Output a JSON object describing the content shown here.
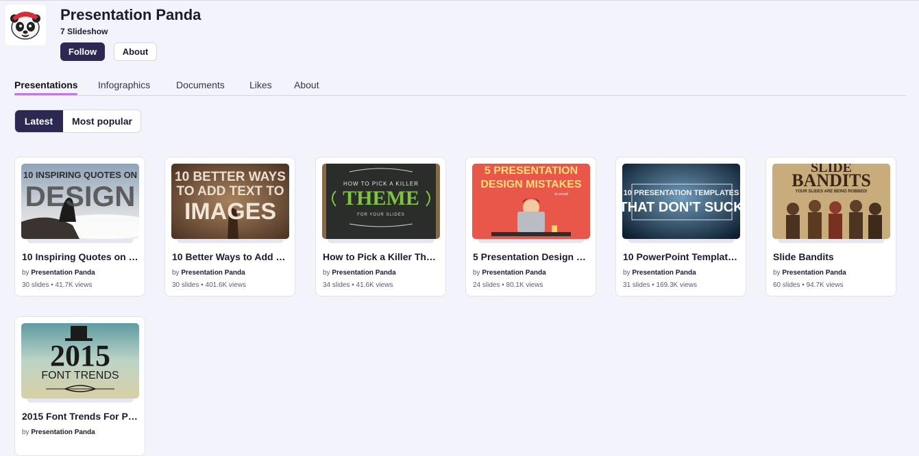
{
  "profile": {
    "name": "Presentation Panda",
    "subtitle": "7 Slideshow",
    "follow_label": "Follow",
    "about_label": "About",
    "avatar_icon": "panda-logo-icon"
  },
  "tabs": [
    {
      "label": "Presentations",
      "active": true
    },
    {
      "label": "Infographics",
      "active": false
    },
    {
      "label": "Documents",
      "active": false
    },
    {
      "label": "Likes",
      "active": false
    },
    {
      "label": "About",
      "active": false
    }
  ],
  "sort": {
    "latest_label": "Latest",
    "popular_label": "Most popular",
    "selected": "Latest"
  },
  "colors": {
    "primary": "#2b2851",
    "tab_accent": "#c07ad8",
    "background": "#f3f4fb"
  },
  "cards": [
    {
      "title": "10 Inspiring Quotes on …",
      "by_prefix": "by",
      "author": "Presentation Panda",
      "meta": "30 slides • 41.7K views",
      "thumb_lines": [
        "10 INSPIRING QUOTES ON",
        "DESIGN"
      ]
    },
    {
      "title": "10 Better Ways to Add T…",
      "by_prefix": "by",
      "author": "Presentation Panda",
      "meta": "30 slides • 401.6K views",
      "thumb_lines": [
        "10 BETTER WAYS",
        "TO ADD TEXT TO",
        "IMAGES"
      ]
    },
    {
      "title": "How to Pick a Killer The…",
      "by_prefix": "by",
      "author": "Presentation Panda",
      "meta": "34 slides • 41.6K views",
      "thumb_lines": [
        "HOW TO PICK A KILLER",
        "THEME",
        "FOR YOUR SLIDES"
      ]
    },
    {
      "title": "5 Presentation Design …",
      "by_prefix": "by",
      "author": "Presentation Panda",
      "meta": "24 slides • 80.1K views",
      "thumb_lines": [
        "5 PRESENTATION",
        "DESIGN MISTAKES",
        "to avoid"
      ]
    },
    {
      "title": "10 PowerPoint Templat…",
      "by_prefix": "by",
      "author": "Presentation Panda",
      "meta": "31 slides • 169.3K views",
      "thumb_lines": [
        "10 PRESENTATION TEMPLATES",
        "THAT DON'T SUCK"
      ]
    },
    {
      "title": "Slide Bandits",
      "by_prefix": "by",
      "author": "Presentation Panda",
      "meta": "60 slides • 94.7K views",
      "thumb_lines": [
        "SLIDE",
        "BANDITS",
        "YOUR SLIDES ARE BEING ROBBED!"
      ]
    },
    {
      "title": "2015 Font Trends For Pr…",
      "by_prefix": "by",
      "author": "Presentation Panda",
      "meta": "",
      "thumb_lines": [
        "2015",
        "FONT TRENDS"
      ]
    }
  ]
}
